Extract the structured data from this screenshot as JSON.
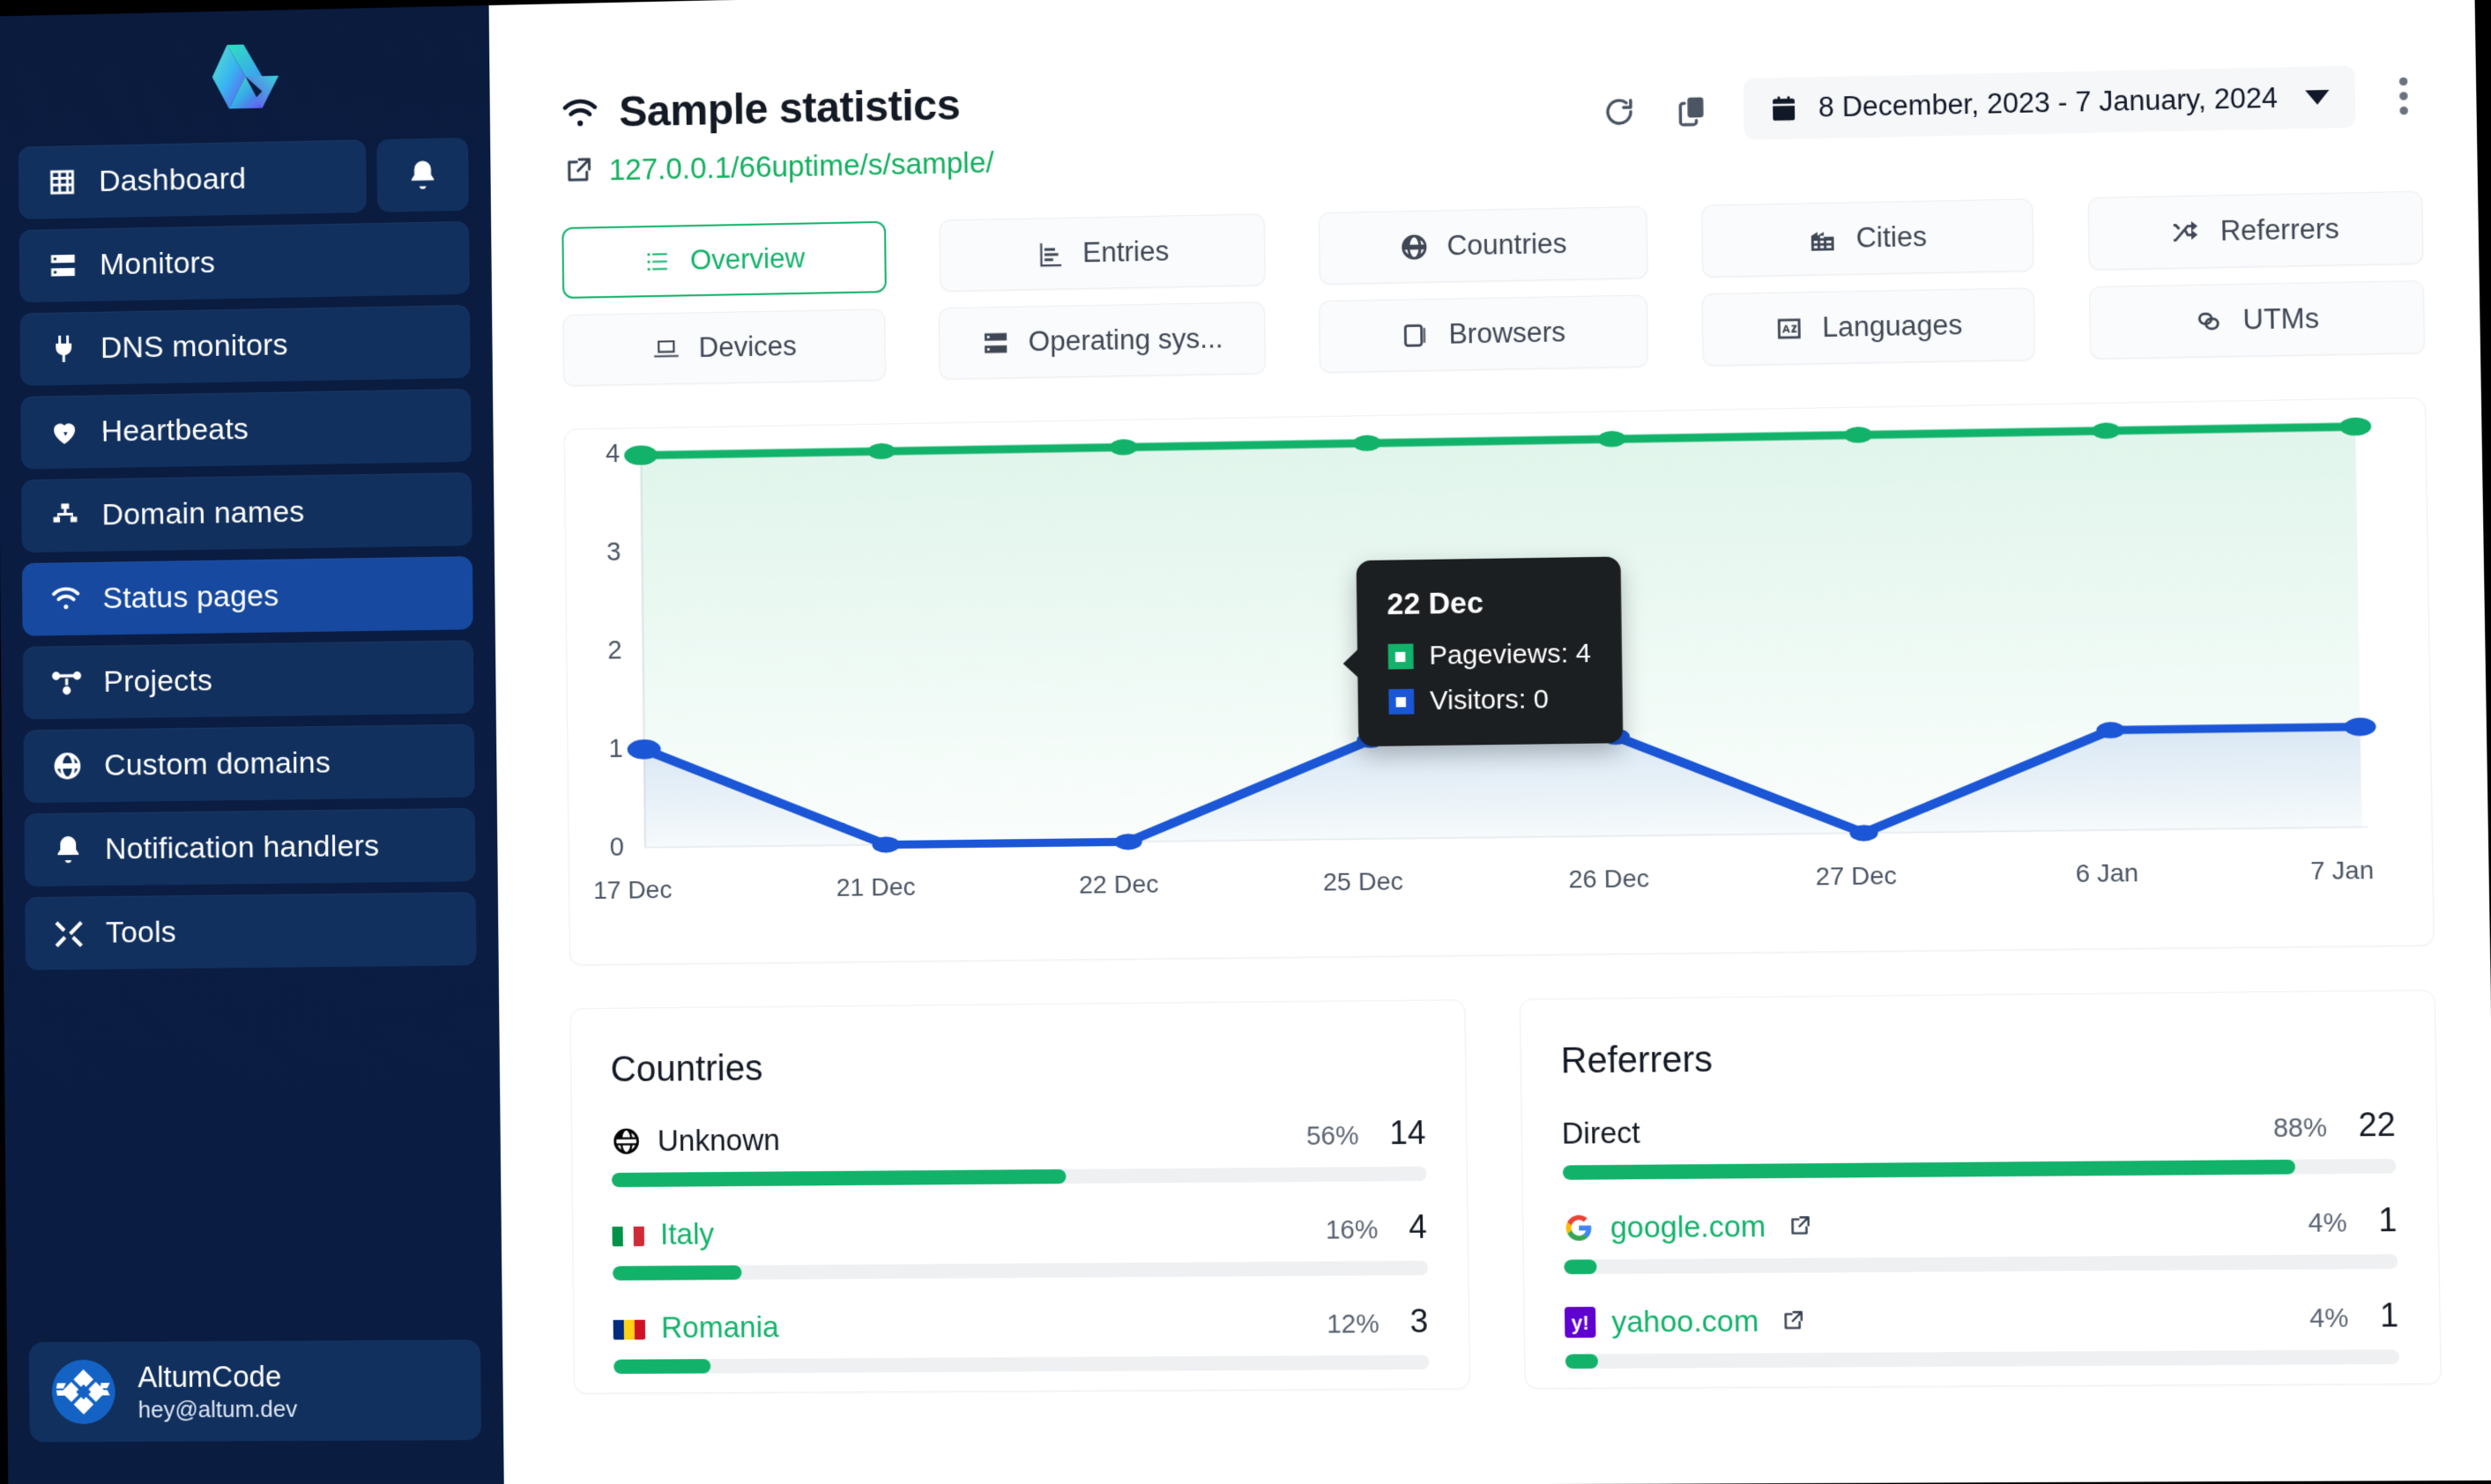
{
  "brand": {
    "logo_name": "altumcode-logo"
  },
  "sidebar": {
    "items": [
      {
        "label": "Dashboard",
        "icon": "grid-icon",
        "active": false
      },
      {
        "label": "Monitors",
        "icon": "server-icon",
        "active": false
      },
      {
        "label": "DNS monitors",
        "icon": "plug-icon",
        "active": false
      },
      {
        "label": "Heartbeats",
        "icon": "heartbeat-icon",
        "active": false
      },
      {
        "label": "Domain names",
        "icon": "sitemap-icon",
        "active": false
      },
      {
        "label": "Status pages",
        "icon": "wifi-icon",
        "active": true
      },
      {
        "label": "Projects",
        "icon": "project-icon",
        "active": false
      },
      {
        "label": "Custom domains",
        "icon": "globe-icon",
        "active": false
      },
      {
        "label": "Notification handlers",
        "icon": "bell-icon",
        "active": false
      },
      {
        "label": "Tools",
        "icon": "tools-icon",
        "active": false
      }
    ],
    "notifications_button": {
      "icon": "bell-icon"
    },
    "user": {
      "name": "AltumCode",
      "email": "hey@altum.dev",
      "avatar": "user-avatar"
    }
  },
  "header": {
    "title": "Sample statistics",
    "title_icon": "wifi-icon",
    "url": "127.0.0.1/66uptime/s/sample/",
    "url_icon": "external-link-icon",
    "refresh_icon": "refresh-icon",
    "copy_icon": "copy-icon",
    "date_range": "8 December, 2023 - 7 January, 2024",
    "date_icon": "calendar-icon",
    "more_icon": "kebab-menu-icon"
  },
  "tabs": [
    {
      "label": "Overview",
      "icon": "list-icon",
      "active": true
    },
    {
      "label": "Entries",
      "icon": "bar-chart-icon",
      "active": false
    },
    {
      "label": "Countries",
      "icon": "globe-icon",
      "active": false
    },
    {
      "label": "Cities",
      "icon": "city-icon",
      "active": false
    },
    {
      "label": "Referrers",
      "icon": "shuffle-icon",
      "active": false
    },
    {
      "label": "Devices",
      "icon": "laptop-icon",
      "active": false
    },
    {
      "label": "Operating sys...",
      "icon": "server-icon",
      "active": false
    },
    {
      "label": "Browsers",
      "icon": "browser-icon",
      "active": false
    },
    {
      "label": "Languages",
      "icon": "translate-icon",
      "active": false
    },
    {
      "label": "UTMs",
      "icon": "link-icon",
      "active": false
    }
  ],
  "chart_data": {
    "type": "line",
    "title": "",
    "xlabel": "",
    "ylabel": "",
    "x": [
      "17 Dec",
      "21 Dec",
      "22 Dec",
      "25 Dec",
      "26 Dec",
      "27 Dec",
      "6 Jan",
      "7 Jan"
    ],
    "yticks": [
      "0",
      "1",
      "2",
      "3",
      "4"
    ],
    "ylim": [
      0,
      4
    ],
    "grid": false,
    "legend": "none",
    "series": [
      {
        "name": "Pageviews",
        "color": "#12b26a",
        "values": [
          4,
          4,
          4,
          4,
          4,
          4,
          4,
          4
        ]
      },
      {
        "name": "Visitors",
        "color": "#1a56d6",
        "values": [
          1,
          0,
          0,
          1,
          1,
          0,
          1,
          1
        ]
      }
    ]
  },
  "tooltip": {
    "date": "22 Dec",
    "rows": [
      {
        "label": "Pageviews: 4",
        "color": "#12b26a"
      },
      {
        "label": "Visitors: 0",
        "color": "#1a56d6"
      }
    ]
  },
  "countries_panel": {
    "title": "Countries",
    "rows": [
      {
        "name": "Unknown",
        "icon": "globe-icon",
        "flag": null,
        "percent": "56%",
        "value": "14",
        "bar": 56,
        "link": false
      },
      {
        "name": "Italy",
        "icon": "flag-icon",
        "flag": "italy",
        "percent": "16%",
        "value": "4",
        "bar": 16,
        "link": true
      },
      {
        "name": "Romania",
        "icon": "flag-icon",
        "flag": "romania",
        "percent": "12%",
        "value": "3",
        "bar": 12,
        "link": true
      }
    ]
  },
  "referrers_panel": {
    "title": "Referrers",
    "rows": [
      {
        "name": "Direct",
        "icon": null,
        "percent": "88%",
        "value": "22",
        "bar": 88,
        "link": false,
        "external": false
      },
      {
        "name": "google.com",
        "icon": "google-icon",
        "percent": "4%",
        "value": "1",
        "bar": 4,
        "link": true,
        "external": true
      },
      {
        "name": "yahoo.com",
        "icon": "yahoo-icon",
        "percent": "4%",
        "value": "1",
        "bar": 4,
        "link": true,
        "external": true
      }
    ]
  },
  "colors": {
    "accent_green": "#12b26a",
    "accent_blue": "#1a56d6",
    "sidebar_bg": "#0a1c40",
    "sidebar_item": "#11305e",
    "sidebar_active": "#16499f"
  }
}
